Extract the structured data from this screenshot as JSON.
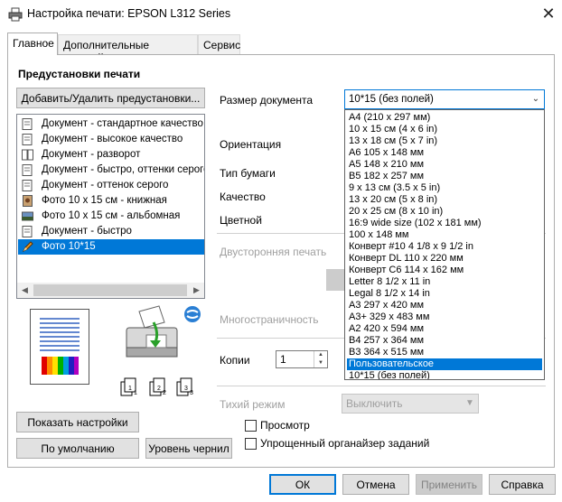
{
  "window": {
    "title": "Настройка печати: EPSON L312 Series",
    "close_glyph": "✕"
  },
  "tabs": [
    {
      "label": "Главное",
      "active": true
    },
    {
      "label": "Дополнительные настройки",
      "active": false
    },
    {
      "label": "Сервис",
      "active": false
    }
  ],
  "presets": {
    "heading": "Предустановки печати",
    "add_remove_label": "Добавить/Удалить предустановки...",
    "items": [
      {
        "label": "Документ - стандартное качество",
        "icon": "document-icon"
      },
      {
        "label": "Документ - высокое качество",
        "icon": "document-icon"
      },
      {
        "label": "Документ - разворот",
        "icon": "two-page-icon"
      },
      {
        "label": "Документ - быстро, оттенки серого",
        "icon": "document-icon"
      },
      {
        "label": "Документ - оттенок серого",
        "icon": "document-icon"
      },
      {
        "label": "Фото 10 x 15 см - книжная",
        "icon": "photo-icon"
      },
      {
        "label": "Фото 10 x 15 см - альбомная",
        "icon": "photo-icon"
      },
      {
        "label": "Документ - быстро",
        "icon": "document-icon"
      },
      {
        "label": "Фото 10*15",
        "icon": "pencil-icon",
        "selected": true
      }
    ]
  },
  "scrollbar": {
    "left_glyph": "◀",
    "right_glyph": "▶"
  },
  "left_buttons": {
    "show_settings": "Показать настройки",
    "defaults": "По умолчанию",
    "ink_levels": "Уровень чернил"
  },
  "copies_icon_numbers": [
    "1",
    "1",
    "2",
    "2",
    "3",
    "3"
  ],
  "settings": {
    "doc_size_label": "Размер документа",
    "orientation_label": "Ориентация",
    "paper_type_label": "Тип бумаги",
    "quality_label": "Качество",
    "color_label": "Цветной",
    "duplex_label": "Двусторонняя печать",
    "multipage_label": "Многостраничность",
    "copies_label": "Копии",
    "copies_value": "1",
    "quiet_label": "Тихий режим",
    "quiet_value": "Выключить",
    "preview_label": "Просмотр",
    "job_arranger_label": "Упрощенный органайзер заданий"
  },
  "glyphs": {
    "down_arrow": "▼",
    "up_arrow": "▲",
    "combo_chevron": "⌄"
  },
  "doc_size": {
    "current": "10*15 (без полей)",
    "options": [
      "A4 (210 x 297 мм)",
      "10 x 15 см (4 x 6 in)",
      "13 x 18 см (5 x 7 in)",
      "A6 105 x 148 мм",
      "A5 148 x 210 мм",
      "B5 182 x 257 мм",
      "9 x 13 см (3.5 x 5 in)",
      "13 x 20 см (5 x 8 in)",
      "20 x 25 см (8 x 10 in)",
      "16:9 wide size (102 x 181 мм)",
      "100 x 148 мм",
      "Конверт #10 4 1/8 x 9 1/2 in",
      "Конверт DL  110 x 220 мм",
      "Конверт C6  114 x 162 мм",
      "Letter 8 1/2 x 11 in",
      "Legal 8 1/2 x 14 in",
      "A3 297 x 420 мм",
      "A3+ 329 x 483 мм",
      "A2 420 x 594 мм",
      "B4 257 x 364 мм",
      "B3 364 x 515 мм",
      "Пользовательское",
      "10*15 (без полей)"
    ],
    "highlighted_index": 21
  },
  "dialog_buttons": {
    "ok": "ОК",
    "cancel": "Отмена",
    "apply": "Применить",
    "help": "Справка"
  },
  "colors": {
    "accent": "#0078d7",
    "button_face": "#e1e1e1",
    "disabled_text": "#a0a0a0"
  }
}
